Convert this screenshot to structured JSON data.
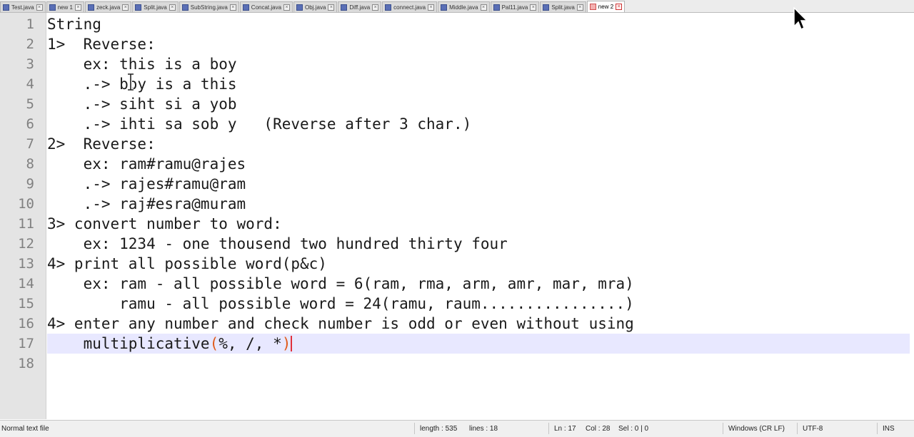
{
  "tabs": [
    {
      "label": "Test.java",
      "active": false
    },
    {
      "label": "new 1",
      "active": false
    },
    {
      "label": "zeck.java",
      "active": false
    },
    {
      "label": "Split.java",
      "active": false
    },
    {
      "label": "SubString.java",
      "active": false
    },
    {
      "label": "Concat.java",
      "active": false
    },
    {
      "label": "Obj.java",
      "active": false
    },
    {
      "label": "Diff.java",
      "active": false
    },
    {
      "label": "connect.java",
      "active": false
    },
    {
      "label": "Middle.java",
      "active": false
    },
    {
      "label": "Pal11.java",
      "active": false
    },
    {
      "label": "Split.java",
      "active": false
    },
    {
      "label": "new 2",
      "active": true
    }
  ],
  "editor": {
    "lines": [
      {
        "num": "1",
        "text": "String"
      },
      {
        "num": "2",
        "text": "1>  Reverse:"
      },
      {
        "num": "3",
        "text": "    ex: this is a boy"
      },
      {
        "num": "4",
        "text": "    .-> boy is a this"
      },
      {
        "num": "5",
        "text": "    .-> siht si a yob"
      },
      {
        "num": "6",
        "text": "    .-> ihti sa sob y   (Reverse after 3 char.)"
      },
      {
        "num": "7",
        "text": "2>  Reverse:"
      },
      {
        "num": "8",
        "text": "    ex: ram#ramu@rajes"
      },
      {
        "num": "9",
        "text": "    .-> rajes#ramu@ram"
      },
      {
        "num": "10",
        "text": "    .-> raj#esra@muram"
      },
      {
        "num": "11",
        "text": "3> convert number to word:"
      },
      {
        "num": "12",
        "text": "    ex: 1234 - one thousend two hundred thirty four"
      },
      {
        "num": "13",
        "text": "4> print all possible word(p&c)"
      },
      {
        "num": "14",
        "text": "    ex: ram - all possible word = 6(ram, rma, arm, amr, mar, mra)"
      },
      {
        "num": "15",
        "text": "        ramu - all possible word = 24(ramu, raum................)"
      },
      {
        "num": "16",
        "text": "4> enter any number and check number is odd or even without using"
      },
      {
        "num": "17",
        "text": ""
      },
      {
        "num": "18",
        "text": ""
      }
    ],
    "current_line": {
      "prefix": "    multiplicative",
      "paren_open": "(",
      "middle": "%, /, *",
      "paren_close": ")"
    }
  },
  "status_bar": {
    "file_type": "Normal text file",
    "length": "length : 535",
    "lines": "lines : 18",
    "ln": "Ln : 17",
    "col": "Col : 28",
    "sel": "Sel : 0 | 0",
    "eol": "Windows (CR LF)",
    "encoding": "UTF-8",
    "mode": "INS"
  },
  "colors": {
    "current_line_bg": "#e8e8ff",
    "brace_highlight": "#e05a1a",
    "gutter_bg": "#e4e4e4"
  }
}
